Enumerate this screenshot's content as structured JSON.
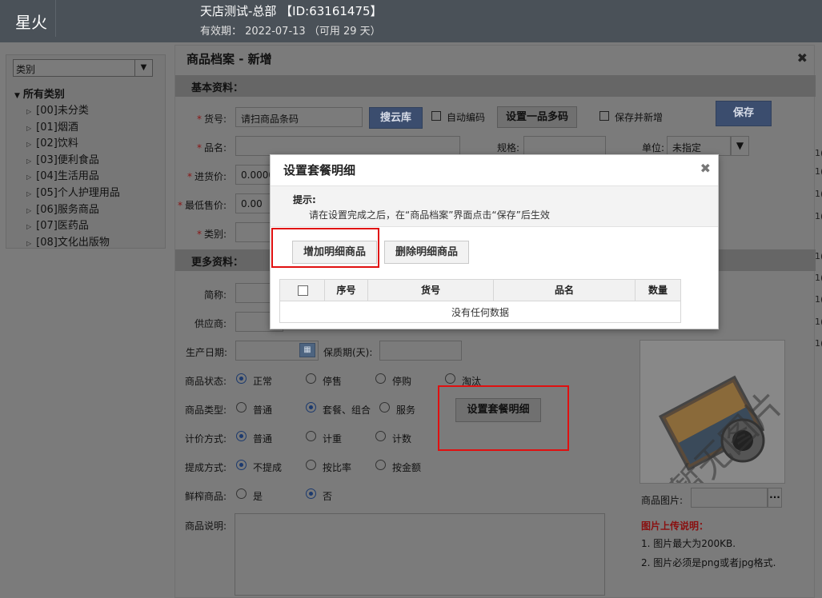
{
  "header": {
    "brand": "星火",
    "store_name": "天店测试-总部 【ID:63161475】",
    "validity": "有效期： 2022-07-13 （可用 29 天）"
  },
  "category_panel": {
    "select_value": "类别",
    "root": "所有类别",
    "items": [
      "[00]未分类",
      "[01]烟酒",
      "[02]饮料",
      "[03]便利食品",
      "[04]生活用品",
      "[05]个人护理用品",
      "[06]服务商品",
      "[07]医药品",
      "[08]文化出版物"
    ]
  },
  "product_modal": {
    "title": "商品档案 - 新增",
    "basic_section": "基本资料：",
    "more_section": "更多资料：",
    "labels": {
      "sku": "货号:",
      "name": "品名:",
      "purchase_price": "进货价:",
      "min_price": "最低售价:",
      "category": "类别:",
      "spec": "规格:",
      "unit": "单位:",
      "short_name": "简称:",
      "supplier": "供应商:",
      "prod_date": "生产日期:",
      "shelf_life": "保质期(天):",
      "status": "商品状态:",
      "type": "商品类型:",
      "pricing": "计价方式:",
      "commission": "提成方式:",
      "fresh": "鲜榨商品:",
      "description": "商品说明:",
      "image": "商品图片:"
    },
    "sku_placeholder": "请扫商品条码",
    "purchase_price_value": "0.0000",
    "min_price_value": "0.00",
    "unit_value": "未指定",
    "buttons": {
      "search_cloud": "搜云库",
      "multi_code": "设置一品多码",
      "save": "保存",
      "set_combo": "设置套餐明细"
    },
    "checkboxes": {
      "auto_code": "自动编码",
      "save_and_new": "保存并新增"
    },
    "status_options": [
      "正常",
      "停售",
      "停购",
      "淘汰"
    ],
    "type_options": [
      "普通",
      "套餐、组合",
      "服务"
    ],
    "pricing_options": [
      "普通",
      "计重",
      "计数"
    ],
    "commission_options": [
      "不提成",
      "按比率",
      "按金额"
    ],
    "fresh_options": [
      "是",
      "否"
    ],
    "image_placeholder_text": "暂无图片",
    "image_notes_title": "图片上传说明：",
    "image_notes": [
      "1. 图片最大为200KB.",
      "2. 图片必须是png或者jpg格式."
    ]
  },
  "combo_dialog": {
    "title": "设置套餐明细",
    "tip_title": "提示:",
    "tip_text": "请在设置完成之后，在“商品档案”界面点击“保存”后生效",
    "add_button": "增加明细商品",
    "delete_button": "删除明细商品",
    "columns": [
      "序号",
      "货号",
      "品名",
      "数量"
    ],
    "empty_text": "没有任何数据"
  },
  "right_strip_numbers": [
    "1(",
    "1(",
    "1(",
    "1(",
    "1(",
    "1(",
    "1(",
    "1(",
    "1("
  ],
  "colors": {
    "highlight_red": "#e01010",
    "radio_checked": "#1c3a6e",
    "note_red": "#8a1010"
  }
}
